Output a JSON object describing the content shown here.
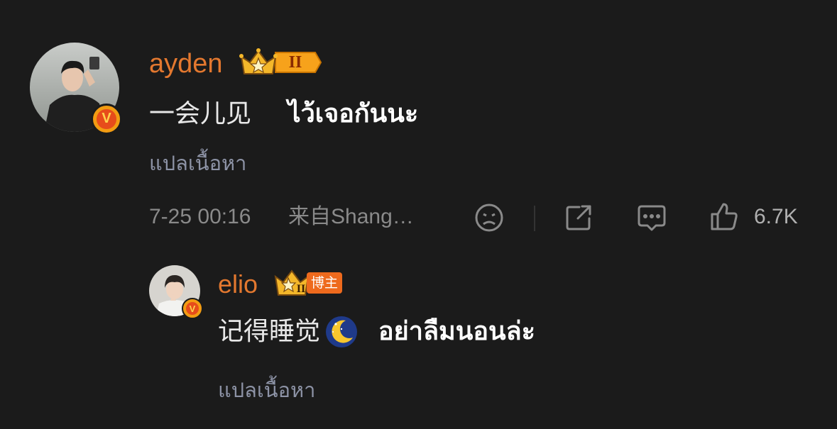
{
  "comment": {
    "username": "ayden",
    "level_badge": "II",
    "text_cn": "一会儿见",
    "text_th": "ไว้เจอกันนะ",
    "translate_label": "แปลเนื้อหา",
    "timestamp": "7-25 00:16",
    "source": "来自Shang…",
    "like_count": "6.7K",
    "icons": [
      "dislike-face-icon",
      "share-icon",
      "comment-icon",
      "like-icon"
    ]
  },
  "reply": {
    "username": "elio",
    "level_badge": "II",
    "tag": "博主",
    "text_cn": "记得睡觉",
    "emoji": "moon-emoji",
    "text_th": "อย่าลืมนอนล่ะ",
    "translate_label": "แปลเนื้อหา"
  },
  "colors": {
    "background": "#1b1b1b",
    "username": "#e3782f",
    "translate": "#8d93a6",
    "meta": "#8a8a8a",
    "badge_orange": "#f39c12"
  }
}
